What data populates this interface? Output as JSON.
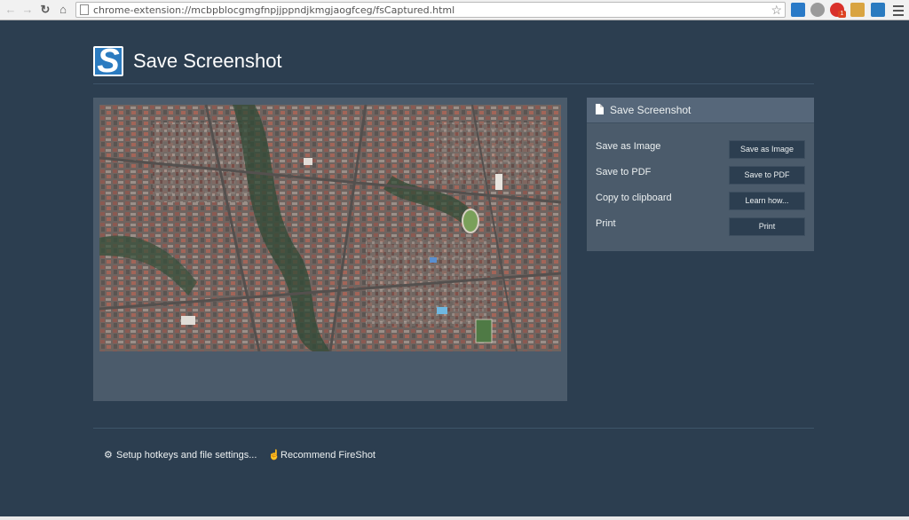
{
  "browser": {
    "url": "chrome-extension://mcbpblocgmgfnpjjppndjkmgjaogfceg/fsCaptured.html",
    "extension_badge": "1"
  },
  "header": {
    "title": "Save Screenshot"
  },
  "sidebar": {
    "title": "Save Screenshot",
    "actions": [
      {
        "label": "Save as Image",
        "button": "Save as Image"
      },
      {
        "label": "Save to PDF",
        "button": "Save to PDF"
      },
      {
        "label": "Copy to clipboard",
        "button": "Learn how..."
      },
      {
        "label": "Print",
        "button": "Print"
      }
    ]
  },
  "footer": {
    "settings_link": "Setup hotkeys and file settings...",
    "recommend_link": "Recommend FireShot"
  },
  "colors": {
    "page_background": "#2c3e50",
    "panel_background": "#4b5b6b",
    "button_background": "#2c3e50",
    "logo_blue": "#2b7bc0"
  },
  "icons": {
    "back": "arrow-left-icon",
    "forward": "arrow-right-icon",
    "reload": "reload-icon",
    "home": "home-icon",
    "bookmark": "star-icon",
    "settings": "gear-icon",
    "recommend": "thumbs-up-icon",
    "document": "document-icon"
  }
}
